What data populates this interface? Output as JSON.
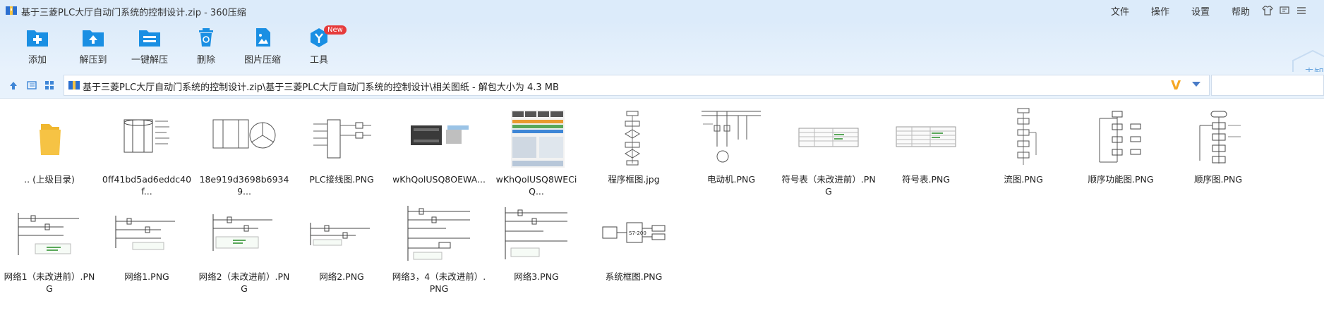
{
  "window": {
    "title": "基于三菱PLC大厅自动门系统的控制设计.zip - 360压缩",
    "menu": [
      "文件",
      "操作",
      "设置",
      "帮助"
    ]
  },
  "toolbar": {
    "buttons": [
      {
        "label": "添加",
        "icon": "add-icon"
      },
      {
        "label": "解压到",
        "icon": "extract-to-icon"
      },
      {
        "label": "一键解压",
        "icon": "one-click-extract-icon"
      },
      {
        "label": "删除",
        "icon": "delete-icon"
      },
      {
        "label": "图片压缩",
        "icon": "image-compress-icon"
      },
      {
        "label": "工具",
        "icon": "tools-icon",
        "badge": "New"
      }
    ],
    "brand_text": "未知"
  },
  "address": {
    "path": "基于三菱PLC大厅自动门系统的控制设计.zip\\基于三菱PLC大厅自动门系统的控制设计\\相关图纸 - 解包大小为 4.3 MB",
    "v_label": "V"
  },
  "files": {
    "row1": [
      {
        "name": ".. (上级目录)",
        "kind": "folder"
      },
      {
        "name": "0ff41bd5ad6eddc40f...",
        "kind": "door-photo"
      },
      {
        "name": "18e919d3698b69349...",
        "kind": "door-drawing"
      },
      {
        "name": "PLC接线图.PNG",
        "kind": "wiring"
      },
      {
        "name": "wKhQolUSQ8OEWA...",
        "kind": "plc-photo"
      },
      {
        "name": "wKhQolUSQ8WECiQ...",
        "kind": "screenshot"
      },
      {
        "name": "程序框图.jpg",
        "kind": "flowchart"
      },
      {
        "name": "电动机.PNG",
        "kind": "motor"
      },
      {
        "name": "符号表（未改进前）.PNG",
        "kind": "table"
      },
      {
        "name": "符号表.PNG",
        "kind": "table"
      },
      {
        "name": "流图.PNG",
        "kind": "flowchart"
      },
      {
        "name": "顺序功能图.PNG",
        "kind": "sfc"
      },
      {
        "name": "顺序图.PNG",
        "kind": "sequence"
      }
    ],
    "row2": [
      {
        "name": "网络1（未改进前）.PNG",
        "kind": "ladder"
      },
      {
        "name": "网络1.PNG",
        "kind": "ladder"
      },
      {
        "name": "网络2（未改进前）.PNG",
        "kind": "ladder"
      },
      {
        "name": "网络2.PNG",
        "kind": "ladder-small"
      },
      {
        "name": "网络3，4（未改进前）.PNG",
        "kind": "ladder-tall"
      },
      {
        "name": "网络3.PNG",
        "kind": "ladder-tall"
      },
      {
        "name": "系统框图.PNG",
        "kind": "block"
      }
    ]
  },
  "colors": {
    "accent": "#1a8fe3",
    "titlebar": "#dcebfa",
    "folder": "#f6c344"
  }
}
